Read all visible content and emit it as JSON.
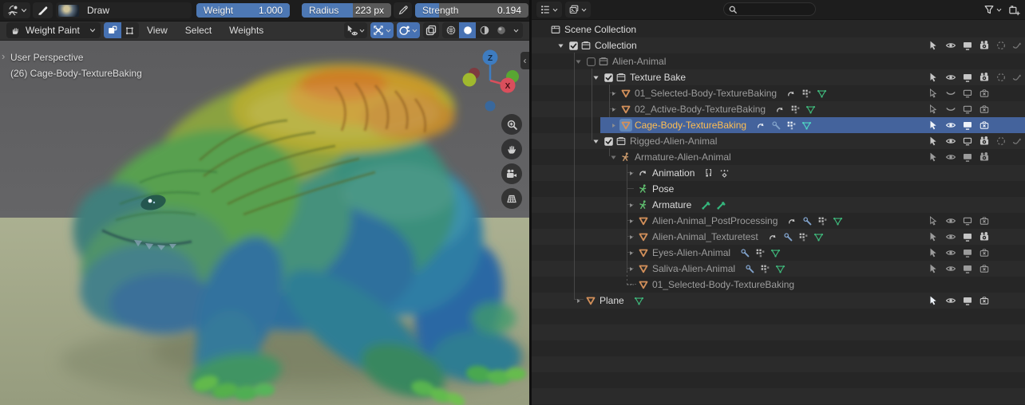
{
  "colors": {
    "accent": "#4772b3",
    "selection_blue": "#44639c",
    "active_object_text": "#ffbe52",
    "mesh_icon_orange": "#d3905a",
    "mesh_data_green": "#3fba7c",
    "viewport_floor": "#a5aa8c",
    "viewport_wall": "#5f5f61"
  },
  "tool_settings": {
    "brush": {
      "name": "Draw"
    },
    "weight": {
      "label": "Weight",
      "value": "1.000",
      "fill": 1.0
    },
    "radius": {
      "label": "Radius",
      "value": "223 px",
      "fill": 0.57
    },
    "strength": {
      "label": "Strength",
      "value": "0.194",
      "fill": 0.21
    }
  },
  "viewport_header": {
    "mode_label": "Weight Paint",
    "menus": [
      {
        "label": "View"
      },
      {
        "label": "Select"
      },
      {
        "label": "Weights"
      }
    ],
    "right_buttons": [
      {
        "name": "object-type-visibility",
        "icon": "objvis",
        "chevron": true,
        "active": false
      },
      {
        "name": "show-gizmos",
        "icon": "gizmos",
        "chevron": true,
        "active": true
      },
      {
        "name": "show-overlays",
        "icon": "overlays",
        "chevron": true,
        "active": true
      },
      {
        "name": "toggle-xray",
        "icon": "xray",
        "chevron": false,
        "active": false
      }
    ],
    "shading_buttons": [
      {
        "name": "shading-wireframe",
        "icon": "shade-wire",
        "active": false
      },
      {
        "name": "shading-solid",
        "icon": "shade-solid",
        "active": true
      },
      {
        "name": "shading-material",
        "icon": "shade-material",
        "active": false
      },
      {
        "name": "shading-rendered",
        "icon": "shade-render",
        "active": false
      }
    ]
  },
  "viewport": {
    "overlay_line1": "User Perspective",
    "overlay_line2": "(26) Cage-Body-TextureBaking",
    "gizmo_z": "Z",
    "gizmo_x": "X"
  },
  "outliner": {
    "search_placeholder": "",
    "rows": [
      {
        "label": "Scene Collection",
        "level": 0,
        "expander": "none",
        "checkbox": "none",
        "icon": "scene",
        "icon_class": "c-grey",
        "style": "normal",
        "selected": false,
        "active_icon": false,
        "data_icons": [],
        "toggles": []
      },
      {
        "label": "Collection",
        "level": 1,
        "expander": "open",
        "checkbox": "checked",
        "icon": "collection",
        "icon_class": "c-grey",
        "style": "normal",
        "selected": false,
        "active_icon": false,
        "data_icons": [],
        "toggles": [
          "cursor",
          "eye",
          "screen",
          "camera",
          "holdout:dim",
          "indirect:dim"
        ]
      },
      {
        "label": "Alien-Animal",
        "level": 2,
        "expander": "open-dim",
        "checkbox": "empty",
        "icon": "collection",
        "icon_class": "c-greydim",
        "style": "dim",
        "selected": false,
        "active_icon": false,
        "data_icons": [],
        "toggles": []
      },
      {
        "label": "Texture Bake",
        "level": 3,
        "expander": "open",
        "checkbox": "checked",
        "icon": "collection",
        "icon_class": "c-grey",
        "style": "normal",
        "selected": false,
        "active_icon": false,
        "data_icons": [],
        "toggles": [
          "cursor",
          "eye",
          "screen",
          "camera",
          "holdout:dim",
          "indirect:dim"
        ]
      },
      {
        "label": "01_Selected-Body-TextureBaking",
        "level": 4,
        "expander": "branch",
        "checkbox": "none",
        "icon": "mesh",
        "icon_class": "c-mesh",
        "style": "dim",
        "selected": false,
        "active_icon": false,
        "data_icons": [
          "anim",
          "vgroup",
          "meshdata"
        ],
        "toggles": [
          "cursor-o:mid",
          "eye-closed:mid",
          "screen-o:mid",
          "camera-x:mid"
        ]
      },
      {
        "label": "02_Active-Body-TextureBaking",
        "level": 4,
        "expander": "branch",
        "checkbox": "none",
        "icon": "mesh",
        "icon_class": "c-mesh",
        "style": "dim",
        "selected": false,
        "active_icon": false,
        "data_icons": [
          "anim",
          "vgroup",
          "meshdata"
        ],
        "toggles": [
          "cursor-o:mid",
          "eye-closed:mid",
          "screen-o:mid",
          "camera-x:mid"
        ]
      },
      {
        "label": "Cage-Body-TextureBaking",
        "level": 4,
        "expander": "branch",
        "checkbox": "none",
        "icon": "mesh",
        "icon_class": "c-mesh",
        "style": "active",
        "selected": true,
        "active_icon": true,
        "data_icons": [
          "anim:hi",
          "wrench",
          "vgroup:hi",
          "meshdata-hi"
        ],
        "toggles": [
          "cursor:hi",
          "eye:hi",
          "screen:hi",
          "camera-x:hi"
        ]
      },
      {
        "label": "Rigged-Alien-Animal",
        "level": 3,
        "expander": "open",
        "checkbox": "checked",
        "icon": "collection",
        "icon_class": "c-grey",
        "style": "dim",
        "selected": false,
        "active_icon": false,
        "data_icons": [],
        "toggles": [
          "cursor",
          "eye",
          "screen-o",
          "camera",
          "holdout:dim",
          "indirect:dim"
        ]
      },
      {
        "label": "Armature-Alien-Animal",
        "level": 4,
        "expander": "open-dim",
        "checkbox": "none",
        "icon": "armature",
        "icon_class": "c-arm",
        "style": "dim",
        "selected": false,
        "active_icon": false,
        "data_icons": [],
        "toggles": [
          "cursor:mid",
          "eye:mid",
          "screen:mid",
          "camera:mid"
        ]
      },
      {
        "label": "Animation",
        "level": 5,
        "expander": "branch",
        "checkbox": "none",
        "icon": "anim",
        "icon_class": "c-grey",
        "style": "normal",
        "selected": false,
        "active_icon": false,
        "data_icons": [
          "nla",
          "keys"
        ],
        "toggles": []
      },
      {
        "label": "Pose",
        "level": 5,
        "expander": "none",
        "checkbox": "none",
        "icon": "pose",
        "icon_class": "c-pose",
        "style": "normal",
        "selected": false,
        "active_icon": false,
        "data_icons": [],
        "toggles": []
      },
      {
        "label": "Armature",
        "level": 5,
        "expander": "branch",
        "checkbox": "none",
        "icon": "armdata",
        "icon_class": "c-pose",
        "style": "normal",
        "selected": false,
        "active_icon": false,
        "data_icons": [
          "bone",
          "bone"
        ],
        "toggles": []
      },
      {
        "label": "Alien-Animal_PostProcessing",
        "level": 5,
        "expander": "branch",
        "checkbox": "none",
        "icon": "mesh",
        "icon_class": "c-mesh",
        "style": "dim",
        "selected": false,
        "active_icon": false,
        "data_icons": [
          "anim",
          "wrench",
          "vgroup",
          "meshdata"
        ],
        "toggles": [
          "cursor-o:mid",
          "eye:mid",
          "screen-o:mid",
          "camera-x:mid"
        ]
      },
      {
        "label": "Alien-Animal_Texturetest",
        "level": 5,
        "expander": "branch",
        "checkbox": "none",
        "icon": "mesh",
        "icon_class": "c-mesh",
        "style": "dim",
        "selected": false,
        "active_icon": false,
        "data_icons": [
          "anim",
          "wrench",
          "vgroup",
          "meshdata"
        ],
        "toggles": [
          "cursor:mid",
          "eye:mid",
          "screen",
          "camera"
        ]
      },
      {
        "label": "Eyes-Alien-Animal",
        "level": 5,
        "expander": "branch",
        "checkbox": "none",
        "icon": "mesh",
        "icon_class": "c-mesh",
        "style": "dim",
        "selected": false,
        "active_icon": false,
        "data_icons": [
          "wrench",
          "vgroup",
          "meshdata"
        ],
        "toggles": [
          "cursor:mid",
          "eye:mid",
          "screen:mid",
          "camera-x:mid"
        ]
      },
      {
        "label": "Saliva-Alien-Animal",
        "level": 5,
        "expander": "branch",
        "checkbox": "none",
        "icon": "mesh",
        "icon_class": "c-mesh",
        "style": "dim",
        "selected": false,
        "active_icon": false,
        "data_icons": [
          "wrench",
          "vgroup",
          "meshdata"
        ],
        "toggles": [
          "cursor:mid",
          "eye:mid",
          "screen:mid",
          "camera-x:mid"
        ]
      },
      {
        "label": "01_Selected-Body-TextureBaking",
        "level": 5,
        "expander": "dash",
        "checkbox": "none",
        "icon": "mesh",
        "icon_class": "c-mesh",
        "style": "dim",
        "selected": false,
        "active_icon": false,
        "data_icons": [],
        "toggles": []
      },
      {
        "label": "Plane",
        "level": 2,
        "expander": "branch",
        "checkbox": "none",
        "icon": "mesh",
        "icon_class": "c-mesh",
        "style": "normal",
        "selected": false,
        "active_icon": false,
        "data_icons": [
          "meshdata"
        ],
        "toggles": [
          "cursor:hi",
          "eye",
          "screen",
          "camera-x"
        ]
      }
    ]
  }
}
